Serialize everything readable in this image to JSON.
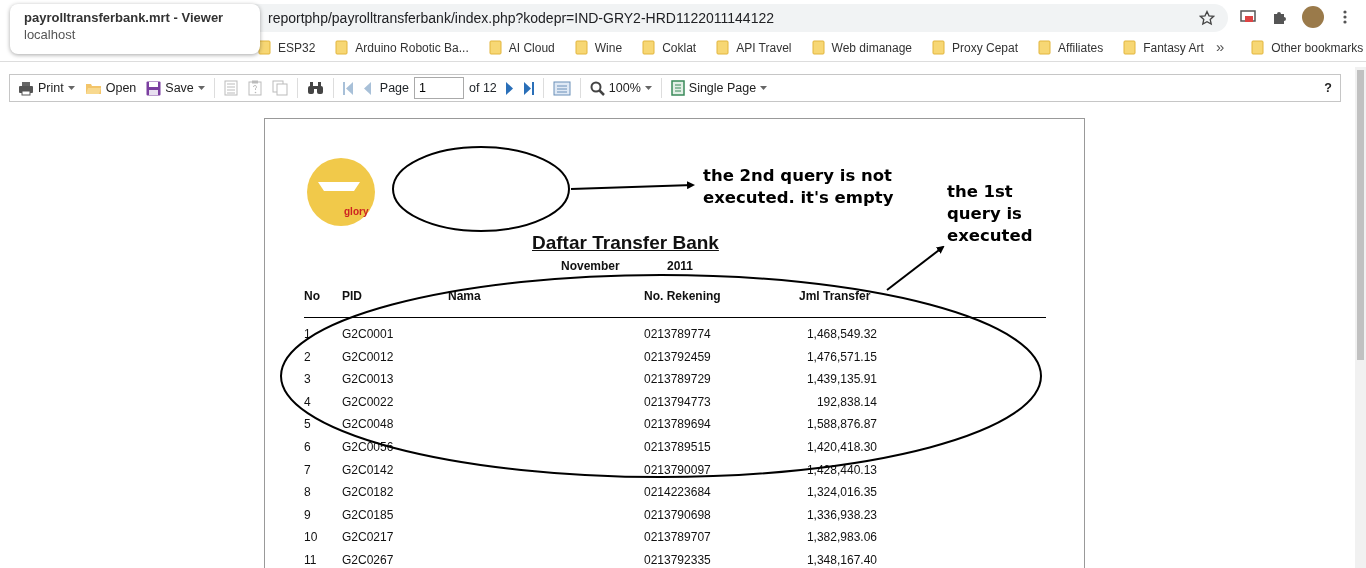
{
  "browser": {
    "tooltip": {
      "title": "payrolltransferbank.mrt - Viewer",
      "host": "localhost"
    },
    "url": "reportphp/payrolltransferbank/index.php?kodepr=IND-GRY2-HRD1122011144122",
    "bookmarks": [
      "ESP32",
      "Arduino Robotic Ba...",
      "AI Cloud",
      "Wine",
      "Coklat",
      "API Travel",
      "Web dimanage",
      "Proxy Cepat",
      "Affiliates",
      "Fantasy Art"
    ],
    "overflow": "»",
    "other_bookmarks": "Other bookmarks"
  },
  "toolbar": {
    "print": "Print",
    "open": "Open",
    "save": "Save",
    "page_label": "Page",
    "page_value": "1",
    "page_total": "of 12",
    "zoom": "100%",
    "view_mode": "Single Page",
    "help": "?"
  },
  "report": {
    "logo_text": "glory",
    "title": "Daftar Transfer Bank",
    "month": "November",
    "year": "2011",
    "columns": [
      "No",
      "PID",
      "Nama",
      "No. Rekening",
      "Jml Transfer"
    ],
    "rows": [
      {
        "no": "1",
        "pid": "G2C0001",
        "rekening": "0213789774",
        "jml": "1,468,549.32"
      },
      {
        "no": "2",
        "pid": "G2C0012",
        "rekening": "0213792459",
        "jml": "1,476,571.15"
      },
      {
        "no": "3",
        "pid": "G2C0013",
        "rekening": "0213789729",
        "jml": "1,439,135.91"
      },
      {
        "no": "4",
        "pid": "G2C0022",
        "rekening": "0213794773",
        "jml": "192,838.14"
      },
      {
        "no": "5",
        "pid": "G2C0048",
        "rekening": "0213789694",
        "jml": "1,588,876.87"
      },
      {
        "no": "6",
        "pid": "G2C0056",
        "rekening": "0213789515",
        "jml": "1,420,418.30"
      },
      {
        "no": "7",
        "pid": "G2C0142",
        "rekening": "0213790097",
        "jml": "1,428,440.13"
      },
      {
        "no": "8",
        "pid": "G2C0182",
        "rekening": "0214223684",
        "jml": "1,324,016.35"
      },
      {
        "no": "9",
        "pid": "G2C0185",
        "rekening": "0213790698",
        "jml": "1,336,938.23"
      },
      {
        "no": "10",
        "pid": "G2C0217",
        "rekening": "0213789707",
        "jml": "1,382,983.06"
      },
      {
        "no": "11",
        "pid": "G2C0267",
        "rekening": "0213792335",
        "jml": "1,348,167.40"
      }
    ]
  },
  "annotations": {
    "note_2nd": "the 2nd query is not executed. it's empty",
    "note_1st": "the 1st query is executed"
  }
}
